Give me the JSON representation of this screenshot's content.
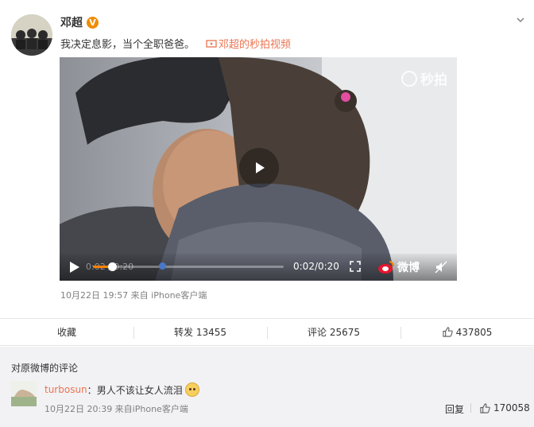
{
  "post": {
    "author": "邓超",
    "verified_badge": "V",
    "text": "我决定息影，当个全职爸爸。",
    "video_link": "邓超的秒拍视频",
    "meta": "10月22日 19:57 来自 iPhone客户端"
  },
  "video": {
    "watermark": "秒拍",
    "time_under": "0:02 / 0:20",
    "time": "0:02/0:20",
    "brand": "微博",
    "progress": 0.1,
    "accent_color": "#ff8200"
  },
  "actions": {
    "favorite": "收藏",
    "repost": "转发 13455",
    "comment": "评论 25675",
    "like": "437805"
  },
  "comments": {
    "header": "对原微博的评论",
    "items": [
      {
        "user": "turbosun",
        "separator": "：",
        "text": "男人不该让女人流泪",
        "meta": "10月22日 20:39 来自iPhone客户端",
        "reply": "回复",
        "likes": "170058"
      }
    ]
  },
  "colors": {
    "link": "#eb7350",
    "badge": "#f08c00",
    "comment_bg": "#f2f2f5"
  }
}
